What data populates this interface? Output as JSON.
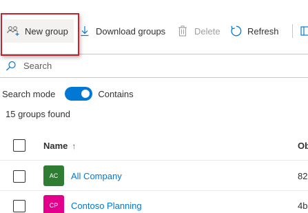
{
  "toolbar": {
    "new_group_label": "New group",
    "download_label": "Download groups",
    "delete_label": "Delete",
    "refresh_label": "Refresh"
  },
  "search": {
    "placeholder": "Search",
    "value": ""
  },
  "search_mode": {
    "label": "Search mode",
    "toggle_on": true,
    "value": "Contains"
  },
  "results": {
    "count_text": "15 groups found"
  },
  "table": {
    "columns": {
      "name": "Name",
      "name_sort": "↑",
      "object_id": "Ob"
    },
    "rows": [
      {
        "initials": "AC",
        "avatar_color": "#2e7d32",
        "name": "All Company",
        "object_id": "82"
      },
      {
        "initials": "CP",
        "avatar_color": "#e3008c",
        "name": "Contoso Planning",
        "object_id": "4b"
      }
    ]
  },
  "colors": {
    "accent": "#0078d4",
    "highlight": "#c8232c"
  },
  "icons": {
    "new_group": "people-add-icon",
    "download": "download-icon",
    "delete": "trash-icon",
    "refresh": "refresh-icon",
    "search": "search-icon",
    "sort": "arrow-up-icon"
  }
}
